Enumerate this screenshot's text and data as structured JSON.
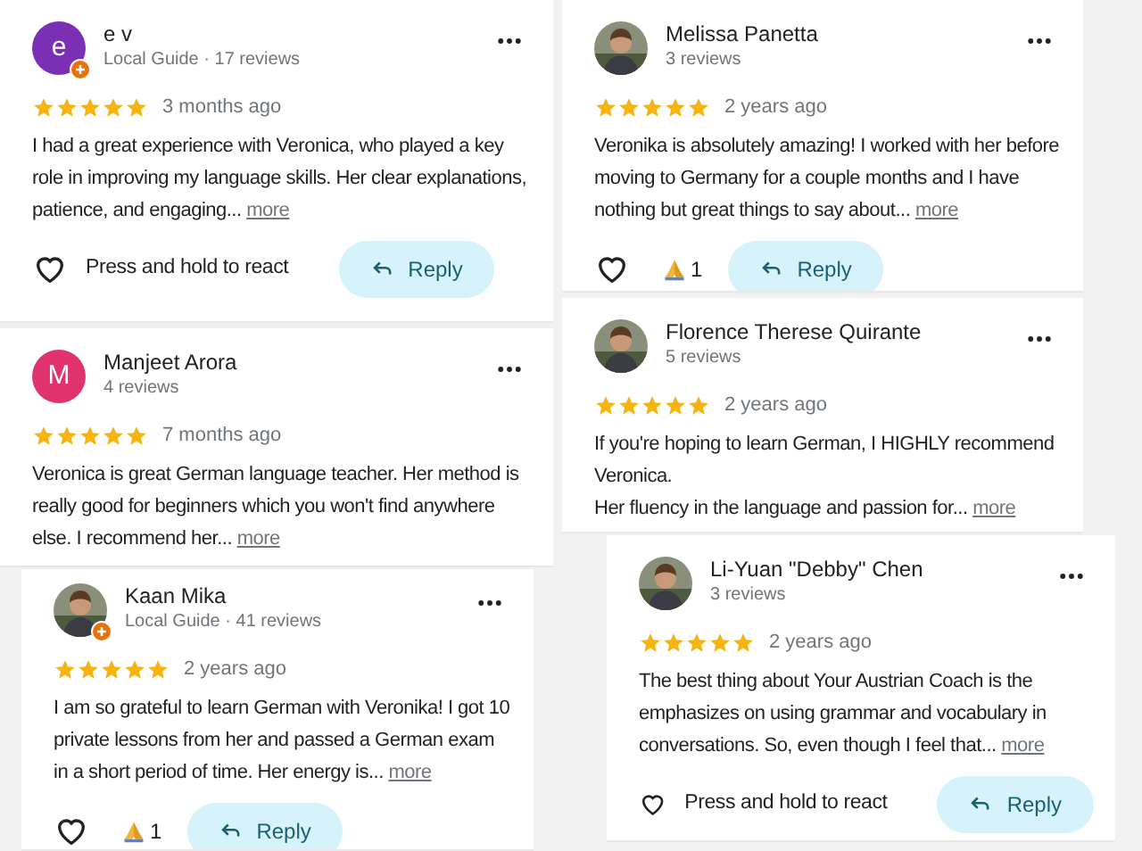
{
  "columns": [
    {
      "cards": [
        {
          "avatar": {
            "kind": "letter",
            "letter": "e",
            "color": "#7b2fb5"
          },
          "local_guide": true,
          "name": "e v",
          "meta": "Local Guide · 17 reviews",
          "stars": 5,
          "time": "3 months ago",
          "text": "I had a great experience with Veronica, who played a key role in improving my language skills. Her clear explanations, patience, and engaging...",
          "more": "more",
          "footer": {
            "kind": "react",
            "label": "Press and hold to react",
            "reply": "Reply"
          }
        },
        {
          "avatar": {
            "kind": "letter",
            "letter": "M",
            "color": "#e0336e"
          },
          "local_guide": false,
          "name": "Manjeet Arora",
          "meta": "4 reviews",
          "stars": 5,
          "time": "7 months ago",
          "text": "Veronica is great German language teacher. Her method is really good for beginners which you won't find anywhere else. I recommend her...",
          "more": "more"
        },
        {
          "local_guide": true,
          "name": "Kaan Mika",
          "meta": "Local Guide · 41 reviews",
          "stars": 5,
          "time": "2 years ago",
          "text": "I am so grateful to learn German with Veronika! I got 10 private lessons from her and passed a German exam in a short period of time. Her energy is...",
          "more": "more",
          "footer": {
            "kind": "reactions",
            "count": "1",
            "reply": "Reply"
          }
        }
      ]
    },
    {
      "cards": [
        {
          "local_guide": false,
          "name": "Melissa Panetta",
          "meta": "3 reviews",
          "stars": 5,
          "time": "2 years ago",
          "text": "Veronika is absolutely amazing! I worked with her before moving to Germany for a couple months and I have nothing but great things to say about...",
          "more": "more",
          "footer": {
            "kind": "reactions",
            "count": "1",
            "reply": "Reply"
          }
        },
        {
          "local_guide": false,
          "name": "Florence Therese Quirante",
          "meta": "5 reviews",
          "stars": 5,
          "time": "2 years ago",
          "text": "If you're hoping to learn German, I HIGHLY recommend Veronica.\nHer fluency in the language and passion for...",
          "more": "more"
        },
        {
          "local_guide": false,
          "name": "Li-Yuan \"Debby\" Chen",
          "meta": "3 reviews",
          "stars": 5,
          "time": "2 years ago",
          "text": "The best thing about Your Austrian Coach is the emphasizes on using grammar and vocabulary in conversations. So, even though I feel that...",
          "more": "more",
          "footer": {
            "kind": "react",
            "label": "Press and hold to react",
            "reply": "Reply"
          }
        }
      ]
    }
  ]
}
